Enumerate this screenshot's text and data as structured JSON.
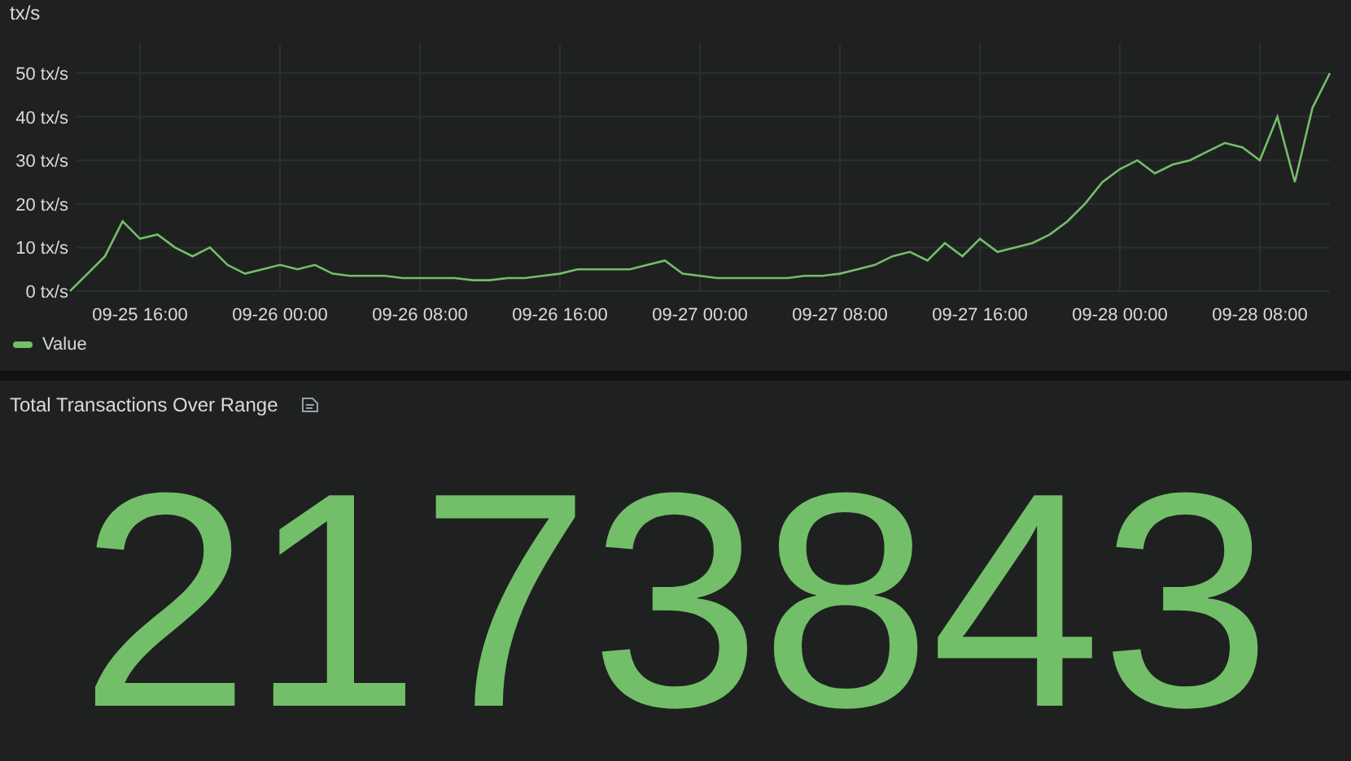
{
  "rate_panel": {
    "title": "tx/s",
    "chart_data": {
      "type": "line",
      "grid": true,
      "categories": [
        null,
        null,
        null,
        null,
        "09-25 16:00",
        null,
        null,
        null,
        null,
        null,
        null,
        null,
        "09-26 00:00",
        null,
        null,
        null,
        null,
        null,
        null,
        null,
        "09-26 08:00",
        null,
        null,
        null,
        null,
        null,
        null,
        null,
        "09-26 16:00",
        null,
        null,
        null,
        null,
        null,
        null,
        null,
        "09-27 00:00",
        null,
        null,
        null,
        null,
        null,
        null,
        null,
        "09-27 08:00",
        null,
        null,
        null,
        null,
        null,
        null,
        null,
        "09-27 16:00",
        null,
        null,
        null,
        null,
        null,
        null,
        null,
        "09-28 00:00",
        null,
        null,
        null,
        null,
        null,
        null,
        null,
        "09-28 08:00",
        null,
        null,
        null,
        null
      ],
      "series": [
        {
          "name": "Value",
          "color": "#73bf69",
          "values": [
            0,
            4,
            8,
            16,
            12,
            13,
            10,
            8,
            10,
            6,
            4,
            5,
            6,
            5,
            6,
            4,
            3.5,
            3.5,
            3.5,
            3,
            3,
            3,
            3,
            2.5,
            2.5,
            3,
            3,
            3.5,
            4,
            5,
            5,
            5,
            5,
            6,
            7,
            4,
            3.5,
            3,
            3,
            3,
            3,
            3,
            3.5,
            3.5,
            4,
            5,
            6,
            8,
            9,
            7,
            11,
            8,
            12,
            9,
            10,
            11,
            13,
            16,
            20,
            25,
            28,
            30,
            27,
            29,
            30,
            32,
            34,
            33,
            30,
            40,
            25,
            42,
            50
          ]
        }
      ],
      "ylim": [
        0,
        50
      ],
      "yticks": [
        {
          "value": 0,
          "label": "0 tx/s"
        },
        {
          "value": 10,
          "label": "10 tx/s"
        },
        {
          "value": 20,
          "label": "20 tx/s"
        },
        {
          "value": 30,
          "label": "30 tx/s"
        },
        {
          "value": 40,
          "label": "40 tx/s"
        },
        {
          "value": 50,
          "label": "50 tx/s"
        }
      ]
    }
  },
  "total_panel": {
    "title": "Total Transactions Over Range",
    "value": "2173843"
  }
}
